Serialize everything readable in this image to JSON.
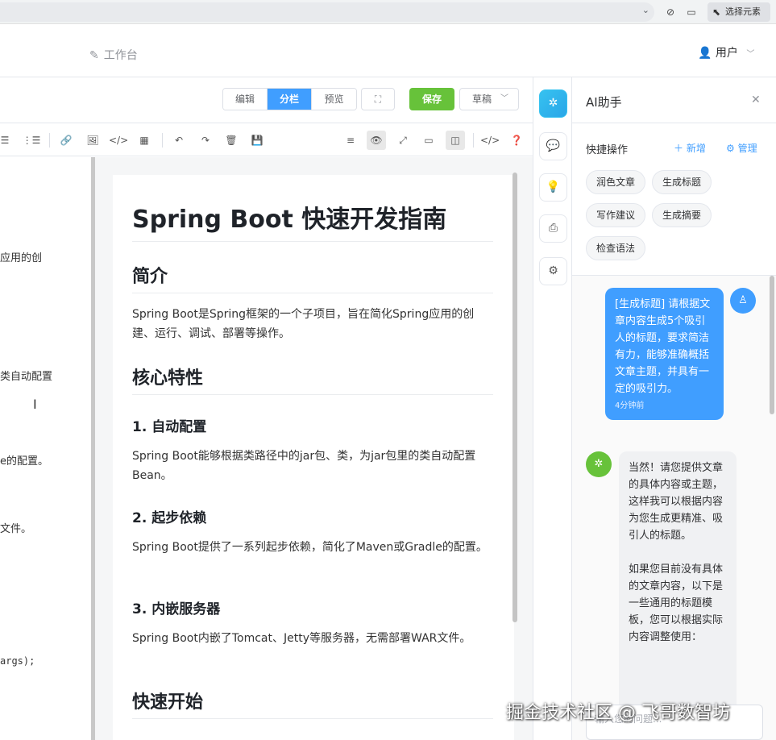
{
  "browser": {
    "select_element_label": "选择元素"
  },
  "header": {
    "workspace_label": "工作台",
    "user_label": "用户"
  },
  "editor_toolbar": {
    "modes": [
      "编辑",
      "分栏",
      "预览"
    ],
    "active_mode": "分栏",
    "save_label": "保存",
    "draft_label": "草稿"
  },
  "source_fragments": [
    {
      "text": "应用的创",
      "top": 0
    },
    {
      "text": "类自动配置",
      "top": 0
    },
    {
      "text": "e的配置。",
      "top": 0
    },
    {
      "text": "文件。",
      "top": 0
    },
    {
      "text": " args);",
      "top": 0
    }
  ],
  "preview": {
    "h1": "Spring Boot 快速开发指南",
    "sections": {
      "intro_h2": "简介",
      "intro_p": "Spring Boot是Spring框架的一个子项目，旨在简化Spring应用的创建、运行、调试、部署等操作。",
      "features_h2": "核心特性",
      "f1_h3": "1. 自动配置",
      "f1_p": "Spring Boot能够根据类路径中的jar包、类，为jar包里的类自动配置Bean。",
      "f2_h3": "2. 起步依赖",
      "f2_p": "Spring Boot提供了一系列起步依赖，简化了Maven或Gradle的配置。",
      "f3_h3": "3. 内嵌服务器",
      "f3_p": "Spring Boot内嵌了Tomcat、Jetty等服务器，无需部署WAR文件。",
      "quickstart_h2": "快速开始"
    }
  },
  "ai_panel": {
    "title": "AI助手",
    "quick_actions_title": "快捷操作",
    "add_label": "新增",
    "manage_label": "管理",
    "chips": [
      "润色文章",
      "生成标题",
      "写作建议",
      "生成摘要",
      "检查语法"
    ],
    "user_message": "[生成标题] 请根据文章内容生成5个吸引人的标题，要求简洁有力，能够准确概括文章主题，并具有一定的吸引力。",
    "user_message_time": "4分钟前",
    "ai_message": "当然！请您提供文章的具体内容或主题，这样我可以根据内容为您生成更精准、吸引人的标题。\n\n如果您目前没有具体的文章内容，以下是一些通用的标题模板，您可以根据实际内容调整使用：",
    "input_placeholder": "输入您的问题..."
  },
  "watermark": "掘金技术社区 @ 飞哥数智坊",
  "colors": {
    "primary": "#409eff",
    "success": "#67c23a",
    "rail_active": "#36c2f0"
  }
}
